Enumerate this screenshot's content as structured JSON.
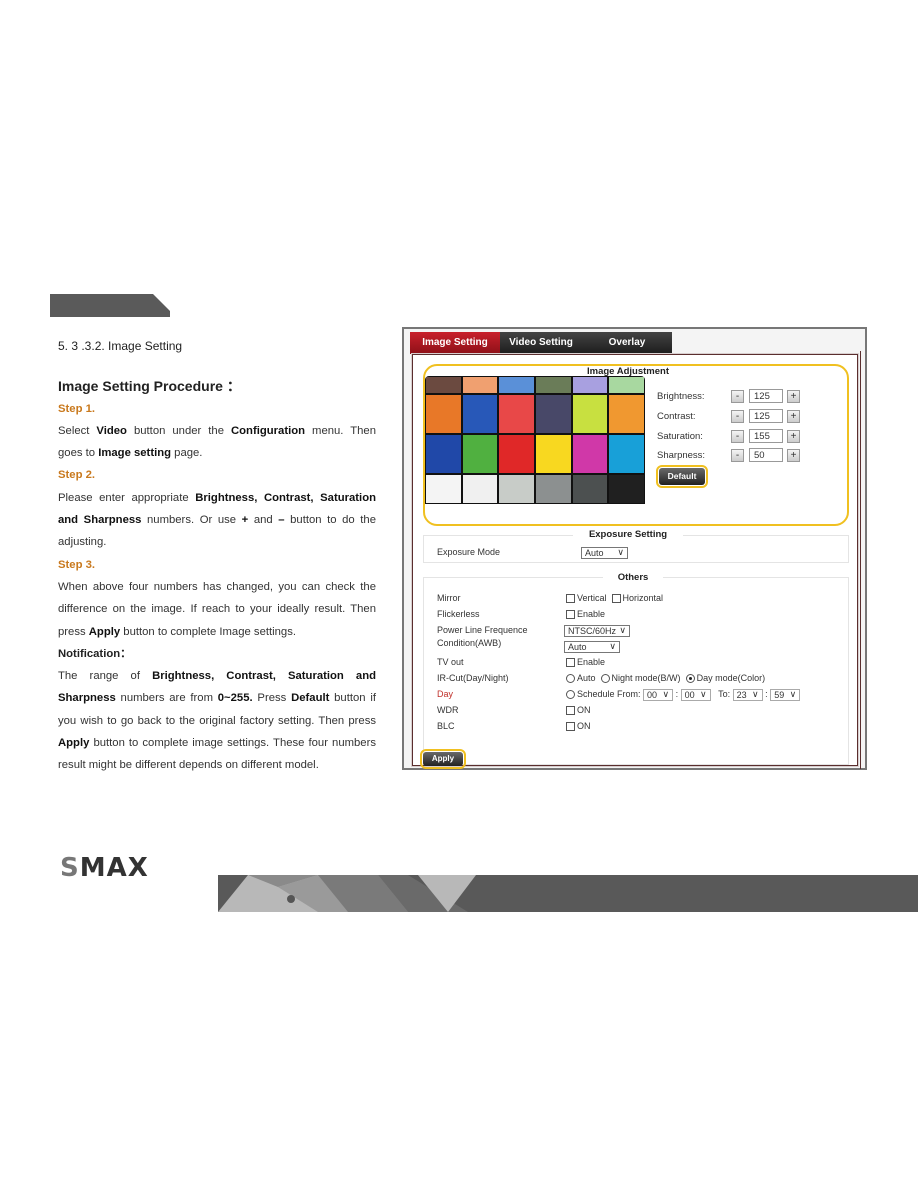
{
  "document": {
    "section_title": "5. 3 .3.2. Image Setting",
    "procedure_title": "Image Setting Procedure ：",
    "steps": [
      {
        "label": "Step 1.",
        "parts": [
          {
            "t": "Select ",
            "b": false
          },
          {
            "t": "Video",
            "b": true
          },
          {
            "t": " button under the ",
            "b": false
          },
          {
            "t": "Configuration",
            "b": true
          },
          {
            "t": " menu. Then goes to ",
            "b": false
          },
          {
            "t": "Image setting",
            "b": true
          },
          {
            "t": " page.",
            "b": false
          }
        ]
      },
      {
        "label": "Step 2.",
        "parts": [
          {
            "t": "Please enter appropriate ",
            "b": false
          },
          {
            "t": "Brightness, Contrast, Saturation and Sharpness",
            "b": true
          },
          {
            "t": " numbers. Or use ",
            "b": false
          },
          {
            "t": "+",
            "b": true
          },
          {
            "t": " and ",
            "b": false
          },
          {
            "t": "–",
            "b": true
          },
          {
            "t": " button to do the adjusting.",
            "b": false
          }
        ]
      },
      {
        "label": "Step 3.",
        "parts": [
          {
            "t": "When above four numbers has changed, you can check the difference on the image. If reach to your ideally result. Then press ",
            "b": false
          },
          {
            "t": "Apply",
            "b": true
          },
          {
            "t": " button to complete Image settings.",
            "b": false
          }
        ]
      }
    ],
    "notification_title": "Notification：",
    "notification_parts": [
      {
        "t": "The range of ",
        "b": false
      },
      {
        "t": "Brightness, Contrast, Saturation and Sharpness",
        "b": true
      },
      {
        "t": " numbers are from ",
        "b": false
      },
      {
        "t": "0~255.",
        "b": true
      },
      {
        "t": " Press ",
        "b": false
      },
      {
        "t": "Default",
        "b": true
      },
      {
        "t": " button if you wish to go back to the original factory setting. Then press ",
        "b": false
      },
      {
        "t": "Apply",
        "b": true
      },
      {
        "t": " button to complete image settings. These four numbers result might be different depends on different model.",
        "b": false
      }
    ]
  },
  "screenshot": {
    "tabs": [
      "Image Setting",
      "Video Setting",
      "Overlay"
    ],
    "active_tab": 0,
    "image_adjustment": {
      "title": "Image Adjustment",
      "controls": [
        {
          "label": "Brightness:",
          "value": "125"
        },
        {
          "label": "Contrast:",
          "value": "125"
        },
        {
          "label": "Saturation:",
          "value": "155"
        },
        {
          "label": "Sharpness:",
          "value": "50"
        }
      ],
      "minus_label": "-",
      "plus_label": "+",
      "default_button": "Default",
      "color_chart_rows": [
        [
          "#6b4a40",
          "#f0a070",
          "#5a90d8",
          "#6a7c58",
          "#a8a0e0",
          "#a8d8a0"
        ],
        [
          "#e87828",
          "#2858b8",
          "#e84848",
          "#484868",
          "#c8e040",
          "#f09830"
        ],
        [
          "#2048a8",
          "#50b040",
          "#e02828",
          "#f8d820",
          "#d038a8",
          "#18a0d8"
        ],
        [
          "#f4f4f4",
          "#f0f0f0",
          "#c8ccc8",
          "#8c9090",
          "#4c5050",
          "#202020"
        ]
      ]
    },
    "exposure": {
      "title": "Exposure Setting",
      "mode_label": "Exposure Mode",
      "mode_value": "Auto"
    },
    "others": {
      "title": "Others",
      "mirror_label": "Mirror",
      "mirror_vertical": "Vertical",
      "mirror_horizontal": "Horizontal",
      "flickerless_label": "Flickerless",
      "flickerless_enable": "Enable",
      "power_line_label": "Power Line Frequence",
      "power_line_value": "NTSC/60Hz",
      "awb_label": "Condition(AWB)",
      "awb_value": "Auto",
      "tv_out_label": "TV out",
      "tv_out_enable": "Enable",
      "ircut_label": "IR-Cut(Day/Night)",
      "ircut_options": [
        "Auto",
        "Night mode(B/W)",
        "Day mode(Color)"
      ],
      "ircut_selected": 2,
      "day_label": "Day",
      "schedule_label": "Schedule From:",
      "from_hour": "00",
      "from_min": "00",
      "to_label": "To:",
      "to_hour": "23",
      "to_min": "59",
      "colon": ":",
      "wdr_label": "WDR",
      "wdr_on": "ON",
      "blc_label": "BLC",
      "blc_on": "ON"
    },
    "apply_button": "Apply"
  },
  "footer": {
    "logo_s": "S",
    "logo_rest": "MAX"
  }
}
